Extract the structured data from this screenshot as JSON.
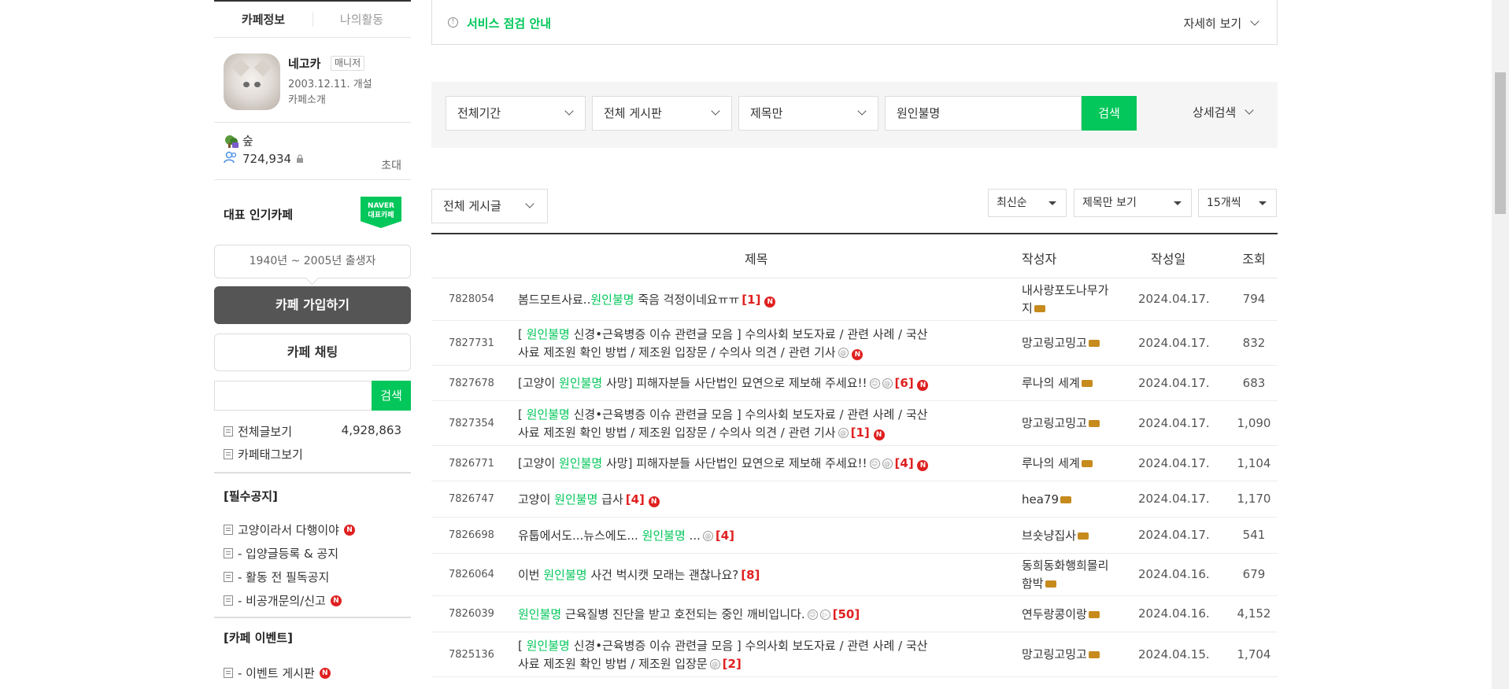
{
  "sidebar": {
    "tabs": [
      {
        "label": "카페정보"
      },
      {
        "label": "나의활동"
      }
    ],
    "cafe": {
      "name": "네고카",
      "role_badge": "매니저",
      "opened": "2003.12.11. 개설",
      "intro_link": "카페소개"
    },
    "level_name": "숲",
    "member_count": "724,934",
    "invite_label": "초대",
    "popular_title": "대표 인기카페",
    "naver_badge_line1": "NAVER",
    "naver_badge_line2": "대표카페",
    "birth_range": "1940년 ~ 2005년 출생자",
    "join_button": "카페 가입하기",
    "chat_button": "카페 채팅",
    "search_button": "검색",
    "all_posts_label": "전체글보기",
    "all_posts_count": "4,928,863",
    "tag_view_label": "카페태그보기",
    "section1_title": "[필수공지]",
    "section1_items": [
      {
        "label": "고양이라서 다행이야",
        "new": "N"
      },
      {
        "label": "- 입양글등록 & 공지"
      },
      {
        "label": "- 활동 전 필독공지"
      },
      {
        "label": "- 비공개문의/신고",
        "new": "N"
      }
    ],
    "section2_title": "[카페 이벤트]",
    "section2_items": [
      {
        "label": "- 이벤트 게시판",
        "new": "N"
      }
    ]
  },
  "notice": {
    "icon": "!",
    "text": "서비스 점검 안내",
    "more": "자세히 보기"
  },
  "search_panel": {
    "period": "전체기간",
    "board": "전체 게시판",
    "scope": "제목만",
    "query": "원인불명",
    "button": "검색",
    "advanced": "상세검색"
  },
  "list_controls": {
    "all_posts": "전체 게시글",
    "sort": "최신순",
    "view_mode": "제목만 보기",
    "per_page": "15개씩"
  },
  "table": {
    "headers": {
      "title": "제목",
      "author": "작성자",
      "date": "작성일",
      "views": "조회"
    },
    "rows": [
      {
        "num": "7828054",
        "pre": "봄드모트사료..",
        "hl": "원인불명",
        "post": " 죽음 걱정이네요ㅠㅠ",
        "icons": "",
        "comments": "[1]",
        "new": "N",
        "author1": "내사랑포도나무가",
        "author2": "지",
        "date": "2024.04.17.",
        "views": "794"
      },
      {
        "num": "7827731",
        "pre": "[ ",
        "hl": "원인불명",
        "post": " 신경•근육병증 이슈 관련글 모음 ] 수의사회 보도자료 / 관련 사례 / 국산",
        "line2": "사료 제조원 확인 방법 / 제조원 입장문 / 수의사 의견 / 관련 기사",
        "icons": "@",
        "comments": "",
        "new": "N",
        "author1": "망고링고밍고",
        "date": "2024.04.17.",
        "views": "832"
      },
      {
        "num": "7827678",
        "pre": "[고양이 ",
        "hl": "원인불명",
        "post": " 사망] 피해자분들 사단법인 묘연으로 제보해 주세요!!",
        "icons": "☺@",
        "comments": "[6]",
        "new": "N",
        "author1": "루나의 세계",
        "date": "2024.04.17.",
        "views": "683"
      },
      {
        "num": "7827354",
        "pre": "[ ",
        "hl": "원인불명",
        "post": " 신경•근육병증 이슈 관련글 모음 ] 수의사회 보도자료 / 관련 사례 / 국산",
        "line2": "사료 제조원 확인 방법 / 제조원 입장문 / 수의사 의견 / 관련 기사",
        "icons": "@",
        "comments": "[1]",
        "new": "N",
        "author1": "망고링고밍고",
        "date": "2024.04.17.",
        "views": "1,090"
      },
      {
        "num": "7826771",
        "pre": "[고양이 ",
        "hl": "원인불명",
        "post": " 사망] 피해자분들 사단법인 묘연으로 제보해 주세요!!",
        "icons": "☺@",
        "comments": "[4]",
        "new": "N",
        "author1": "루나의 세계",
        "date": "2024.04.17.",
        "views": "1,104"
      },
      {
        "num": "7826747",
        "pre": "고양이 ",
        "hl": "원인불명",
        "post": " 급사",
        "icons": "",
        "comments": "[4]",
        "new": "N",
        "author1": "hea79",
        "date": "2024.04.17.",
        "views": "1,170"
      },
      {
        "num": "7826698",
        "pre": "유툽에서도...뉴스에도... ",
        "hl": "원인불명",
        "post": " ...",
        "icons": "@",
        "comments": "[4]",
        "new": "",
        "author1": "브숏냥집사",
        "date": "2024.04.17.",
        "views": "541"
      },
      {
        "num": "7826064",
        "pre": "이번 ",
        "hl": "원인불명",
        "post": " 사건 벅시캣 모래는 괜찮나요?",
        "icons": "",
        "comments": "[8]",
        "new": "",
        "author1": "동희동화행희몰리",
        "author2": "함박",
        "date": "2024.04.16.",
        "views": "679"
      },
      {
        "num": "7826039",
        "pre": "",
        "hl": "원인불명",
        "post": " 근육질병 진단을 받고 호전되는 중인 깨비입니다.",
        "icons": "☺▷",
        "comments": "[50]",
        "new": "",
        "author1": "연두랑콩이랑",
        "date": "2024.04.16.",
        "views": "4,152"
      },
      {
        "num": "7825136",
        "pre": "[ ",
        "hl": "원인불명",
        "post": " 신경•근육병증 이슈 관련글 모음 ] 수의사회 보도자료 / 관련 사례 / 국산",
        "line2": "사료 제조원 확인 방법 / 제조원 입장문",
        "icons": "@",
        "comments": "[2]",
        "new": "",
        "author1": "망고링고밍고",
        "date": "2024.04.15.",
        "views": "1,704"
      }
    ]
  },
  "colors": {
    "accent": "#03c75a",
    "badge_red": "#e02020",
    "join_bg": "#555555"
  }
}
